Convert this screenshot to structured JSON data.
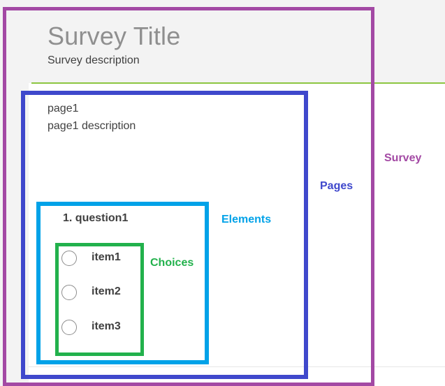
{
  "survey": {
    "title": "Survey Title",
    "description": "Survey description"
  },
  "page": {
    "title": "page1",
    "description": "page1 description"
  },
  "question": {
    "title": "1. question1",
    "choices": [
      "item1",
      "item2",
      "item3"
    ]
  },
  "annotations": {
    "survey": {
      "label": "Survey",
      "color": "#a349a4"
    },
    "pages": {
      "label": "Pages",
      "color": "#3f48cc"
    },
    "elements": {
      "label": "Elements",
      "color": "#00a2e8"
    },
    "choices": {
      "label": "Choices",
      "color": "#22b14c"
    }
  },
  "theme": {
    "accent_line": "#8cc540",
    "header_bg": "#f3f3f3"
  }
}
